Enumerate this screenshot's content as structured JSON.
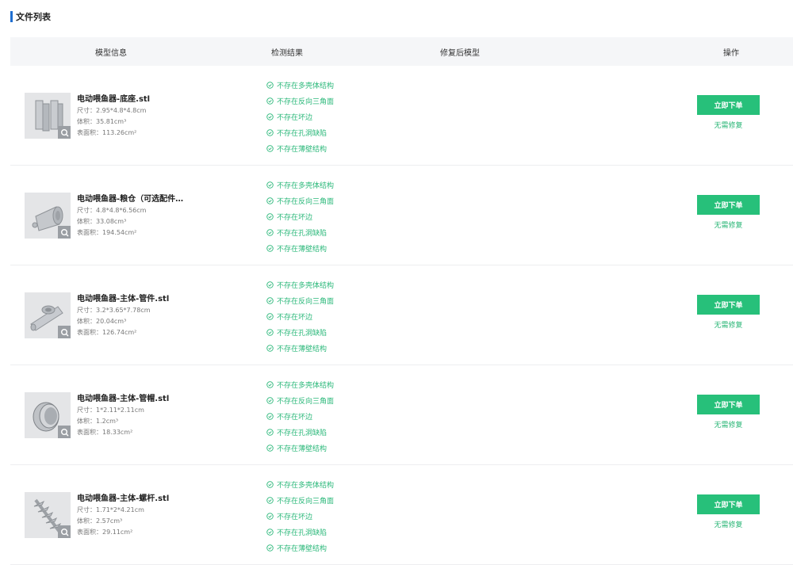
{
  "section": {
    "title": "文件列表"
  },
  "table": {
    "headers": {
      "info": "模型信息",
      "result": "检测结果",
      "repaired": "修复后模型",
      "op": "操作"
    }
  },
  "labels": {
    "size_prefix": "尺寸：",
    "volume_prefix": "体积：",
    "area_prefix": "表面积：",
    "order_button": "立即下单",
    "repair_link": "无需修复"
  },
  "checks": [
    "不存在多壳体结构",
    "不存在反向三角面",
    "不存在坏边",
    "不存在孔洞缺陷",
    "不存在薄壁结构"
  ],
  "rows": [
    {
      "name": "电动喂鱼器-底座.stl",
      "size": "2.95*4.8*4.8cm",
      "volume": "35.81cm³",
      "area": "113.26cm²",
      "thumb_icon": "base-model-icon"
    },
    {
      "name": "电动喂鱼器-粮仓（可选配件…",
      "size": "4.8*4.8*6.56cm",
      "volume": "33.08cm³",
      "area": "194.54cm²",
      "thumb_icon": "silo-model-icon"
    },
    {
      "name": "电动喂鱼器-主体-管件.stl",
      "size": "3.2*3.65*7.78cm",
      "volume": "20.04cm³",
      "area": "126.74cm²",
      "thumb_icon": "pipe-model-icon"
    },
    {
      "name": "电动喂鱼器-主体-管帽.stl",
      "size": "1*2.11*2.11cm",
      "volume": "1.2cm³",
      "area": "18.33cm²",
      "thumb_icon": "cap-model-icon"
    },
    {
      "name": "电动喂鱼器-主体-螺杆.stl",
      "size": "1.71*2*4.21cm",
      "volume": "2.57cm³",
      "area": "29.11cm²",
      "thumb_icon": "screw-model-icon"
    }
  ],
  "colors": {
    "accent": "#1f6fd1",
    "success": "#2bb87a",
    "button": "#27c07a",
    "header_bg": "#f5f6f8"
  }
}
